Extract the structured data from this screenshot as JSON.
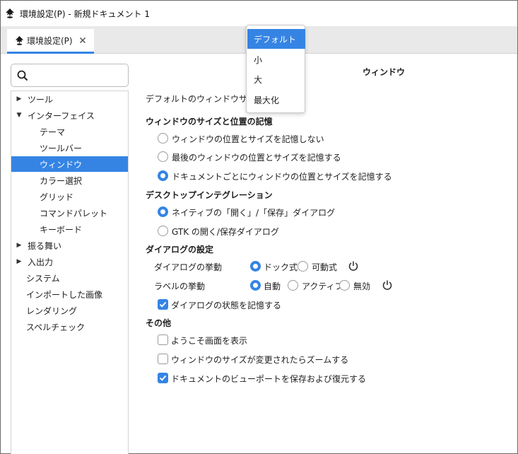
{
  "window": {
    "title": "環境設定(P) - 新規ドキュメント 1"
  },
  "tabs": [
    {
      "label": "環境設定(P)"
    }
  ],
  "search": {
    "placeholder": "",
    "value": ""
  },
  "sidebar": {
    "items": [
      {
        "label": "ツール",
        "arrow": "collapsed"
      },
      {
        "label": "インターフェイス",
        "arrow": "expanded"
      },
      {
        "label": "テーマ"
      },
      {
        "label": "ツールバー"
      },
      {
        "label": "ウィンドウ",
        "selected": true
      },
      {
        "label": "カラー選択"
      },
      {
        "label": "グリッド"
      },
      {
        "label": "コマンドパレット"
      },
      {
        "label": "キーボード"
      },
      {
        "label": "振る舞い",
        "arrow": "collapsed"
      },
      {
        "label": "入出力",
        "arrow": "collapsed"
      },
      {
        "label": "システム"
      },
      {
        "label": "インポートした画像"
      },
      {
        "label": "レンダリング"
      },
      {
        "label": "スペルチェック"
      }
    ]
  },
  "main": {
    "title": "ウィンドウ",
    "default_size_label": "デフォルトのウィンドウサイズ:",
    "size_section": "ウィンドウのサイズと位置の記憶",
    "size_options": [
      {
        "label": "ウィンドウの位置とサイズを記憶しない",
        "checked": false
      },
      {
        "label": "最後のウィンドウの位置とサイズを記憶する",
        "checked": false
      },
      {
        "label": "ドキュメントごとにウィンドウの位置とサイズを記憶する",
        "checked": true
      }
    ],
    "desktop_section": "デスクトップインテグレーション",
    "desktop_options": [
      {
        "label": "ネイティブの「開く」/「保存」ダイアログ",
        "checked": true
      },
      {
        "label": "GTK の開く/保存ダイアログ",
        "checked": false
      }
    ],
    "dialog_section": "ダイアログの設定",
    "dialog_behavior": {
      "label": "ダイアログの挙動",
      "options": [
        {
          "label": "ドック式",
          "checked": true
        },
        {
          "label": "可動式",
          "checked": false
        }
      ]
    },
    "label_behavior": {
      "label": "ラベルの挙動",
      "options": [
        {
          "label": "自動",
          "checked": true
        },
        {
          "label": "アクティブ",
          "checked": false
        },
        {
          "label": "無効",
          "checked": false
        }
      ]
    },
    "remember_dialog": {
      "label": "ダイアログの状態を記憶する",
      "checked": true
    },
    "other_section": "その他",
    "other_options": [
      {
        "label": "ようこそ画面を表示",
        "checked": false
      },
      {
        "label": "ウィンドウのサイズが変更されたらズームする",
        "checked": false
      },
      {
        "label": "ドキュメントのビューポートを保存および復元する",
        "checked": true
      }
    ]
  },
  "dropdown": {
    "options": [
      "デフォルト",
      "小",
      "大",
      "最大化"
    ],
    "selected": "デフォルト"
  },
  "colors": {
    "accent": "#3584e4",
    "tabbar": "#e9e9e9"
  }
}
